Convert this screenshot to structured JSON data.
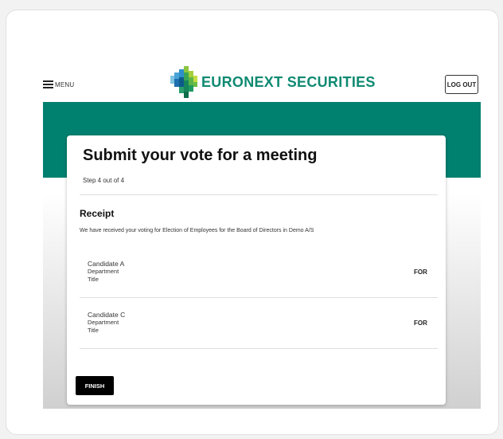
{
  "header": {
    "menu_label": "MENU",
    "logo_text": "EURONEXT SECURITIES",
    "logout_label": "LOG OUT"
  },
  "page": {
    "title": "Submit your vote for a meeting",
    "step": "Step 4 out of 4"
  },
  "receipt": {
    "heading": "Receipt",
    "message": "We have received your voting for Election of Employees for the Board of Directors in Demo A/S",
    "candidates": [
      {
        "name": "Candidate A",
        "department": "Department",
        "title": "Title",
        "vote": "FOR"
      },
      {
        "name": "Candidate C",
        "department": "Department",
        "title": "Title",
        "vote": "FOR"
      }
    ]
  },
  "actions": {
    "finish_label": "FINISH"
  },
  "colors": {
    "brand_green": "#00806f",
    "logo_text": "#0f8a72"
  }
}
